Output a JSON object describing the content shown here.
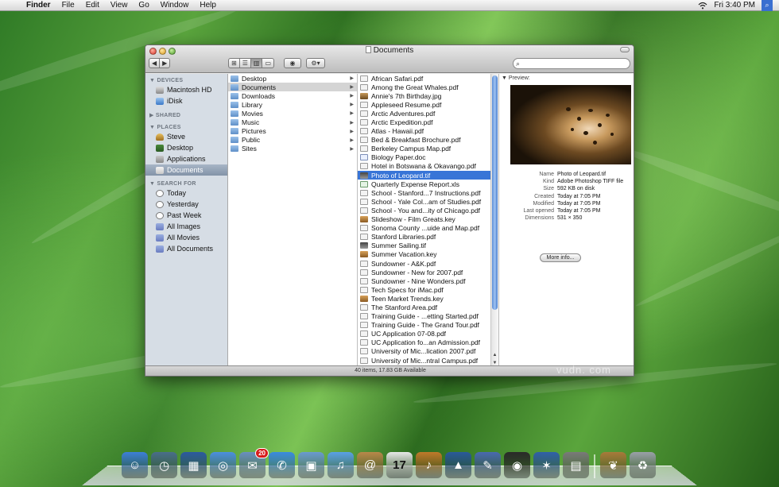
{
  "menubar": {
    "apple_glyph": "",
    "items": [
      "Finder",
      "File",
      "Edit",
      "View",
      "Go",
      "Window",
      "Help"
    ],
    "clock": "Fri 3:40 PM",
    "wifi_icon": "wifi-icon",
    "spotlight_icon": "spotlight-icon"
  },
  "window": {
    "title": "Documents",
    "view_buttons": [
      "icon-view",
      "list-view",
      "column-view",
      "coverflow-view"
    ],
    "search_placeholder": "",
    "status": "40 items, 17.83 GB Available"
  },
  "sidebar": {
    "sections": [
      {
        "header": "▼ DEVICES",
        "items": [
          "Macintosh HD",
          "iDisk"
        ]
      },
      {
        "header": "▶ SHARED",
        "items": []
      },
      {
        "header": "▼ PLACES",
        "items": [
          "Steve",
          "Desktop",
          "Applications",
          "Documents"
        ]
      },
      {
        "header": "▼ SEARCH FOR",
        "items": [
          "Today",
          "Yesterday",
          "Past Week",
          "All Images",
          "All Movies",
          "All Documents"
        ]
      }
    ],
    "selected": "Documents"
  },
  "column1": [
    "Desktop",
    "Documents",
    "Downloads",
    "Library",
    "Movies",
    "Music",
    "Pictures",
    "Public",
    "Sites"
  ],
  "column2": [
    {
      "name": "African Safari.pdf",
      "kind": "pdf"
    },
    {
      "name": "Among the Great Whales.pdf",
      "kind": "pdf"
    },
    {
      "name": "Annie's 7th Birthday.jpg",
      "kind": "img"
    },
    {
      "name": "Appleseed Resume.pdf",
      "kind": "pdf"
    },
    {
      "name": "Arctic Adventures.pdf",
      "kind": "pdf"
    },
    {
      "name": "Arctic Expedition.pdf",
      "kind": "pdf"
    },
    {
      "name": "Atlas - Hawaii.pdf",
      "kind": "pdf"
    },
    {
      "name": "Bed & Breakfast Brochure.pdf",
      "kind": "pdf"
    },
    {
      "name": "Berkeley Campus Map.pdf",
      "kind": "pdf"
    },
    {
      "name": "Biology Paper.doc",
      "kind": "doc"
    },
    {
      "name": "Hotel in Botswana & Okavango.pdf",
      "kind": "pdf"
    },
    {
      "name": "Photo of Leopard.tif",
      "kind": "tif"
    },
    {
      "name": "Quarterly Expense Report.xls",
      "kind": "xls"
    },
    {
      "name": "School - Stanford...7 Instructions.pdf",
      "kind": "pdf"
    },
    {
      "name": "School - Yale Col...am of Studies.pdf",
      "kind": "pdf"
    },
    {
      "name": "School - You and...ity of Chicago.pdf",
      "kind": "pdf"
    },
    {
      "name": "Slideshow - Film Greats.key",
      "kind": "key"
    },
    {
      "name": "Sonoma County ...uide and Map.pdf",
      "kind": "pdf"
    },
    {
      "name": "Stanford Libraries.pdf",
      "kind": "pdf"
    },
    {
      "name": "Summer Sailing.tif",
      "kind": "tif"
    },
    {
      "name": "Summer Vacation.key",
      "kind": "key"
    },
    {
      "name": "Sundowner - A&K.pdf",
      "kind": "pdf"
    },
    {
      "name": "Sundowner - New for 2007.pdf",
      "kind": "pdf"
    },
    {
      "name": "Sundowner - Nine Wonders.pdf",
      "kind": "pdf"
    },
    {
      "name": "Tech Specs for iMac.pdf",
      "kind": "pdf"
    },
    {
      "name": "Teen Market Trends.key",
      "kind": "key"
    },
    {
      "name": "The Stanford Area.pdf",
      "kind": "pdf"
    },
    {
      "name": "Training Guide - ...etting Started.pdf",
      "kind": "pdf"
    },
    {
      "name": "Training Guide - The Grand Tour.pdf",
      "kind": "pdf"
    },
    {
      "name": "UC Application 07-08.pdf",
      "kind": "pdf"
    },
    {
      "name": "UC Application fo...an Admission.pdf",
      "kind": "pdf"
    },
    {
      "name": "University of Mic...lication 2007.pdf",
      "kind": "pdf"
    },
    {
      "name": "University of Mic...ntral Campus.pdf",
      "kind": "pdf"
    }
  ],
  "column2_selected": "Photo of Leopard.tif",
  "preview": {
    "label": "▼ Preview:",
    "meta": [
      {
        "key": "Name",
        "value": "Photo of Leopard.tif"
      },
      {
        "key": "Kind",
        "value": "Adobe Photoshop TIFF file"
      },
      {
        "key": "Size",
        "value": "592 KB on disk"
      },
      {
        "key": "Created",
        "value": "Today at 7:05 PM"
      },
      {
        "key": "Modified",
        "value": "Today at 7:05 PM"
      },
      {
        "key": "Last opened",
        "value": "Today at 7:05 PM"
      },
      {
        "key": "Dimensions",
        "value": "531 × 350"
      }
    ],
    "more_info": "More info..."
  },
  "watermark": "vudn. com",
  "dock": {
    "items": [
      {
        "name": "finder-icon",
        "color": "#3d7fd8",
        "glyph": "☺"
      },
      {
        "name": "time-machine-icon",
        "color": "#4a6e8a",
        "glyph": "◷"
      },
      {
        "name": "spaces-icon",
        "color": "#2c5aa0",
        "glyph": "▦"
      },
      {
        "name": "safari-icon",
        "color": "#4c8fe0",
        "glyph": "◎"
      },
      {
        "name": "mail-icon",
        "color": "#6a8fc0",
        "glyph": "✉",
        "badge": "20"
      },
      {
        "name": "ichat-icon",
        "color": "#3a8be0",
        "glyph": "✆"
      },
      {
        "name": "iphoto-icon",
        "color": "#6a9ad0",
        "glyph": "▣"
      },
      {
        "name": "itunes-icon",
        "color": "#5aa0e6",
        "glyph": "♫"
      },
      {
        "name": "address-book-icon",
        "color": "#b8884a",
        "glyph": "@"
      },
      {
        "name": "ical-icon",
        "color": "#e8e8e8",
        "glyph": "17"
      },
      {
        "name": "garageband-icon",
        "color": "#c07a2a",
        "glyph": "♪"
      },
      {
        "name": "keynote-icon",
        "color": "#2a5a9a",
        "glyph": "▲"
      },
      {
        "name": "iweb-icon",
        "color": "#4a6ab0",
        "glyph": "✎"
      },
      {
        "name": "photo-booth-icon",
        "color": "#2a2a2a",
        "glyph": "◉"
      },
      {
        "name": "imovie-icon",
        "color": "#3060a8",
        "glyph": "✶"
      },
      {
        "name": "preview-icon",
        "color": "#7a7a7a",
        "glyph": "▤"
      },
      {
        "name": "downloads-stack-icon",
        "color": "#a87a3a",
        "glyph": "❦"
      },
      {
        "name": "trash-icon",
        "color": "#9aa0a8",
        "glyph": "♻"
      }
    ]
  }
}
